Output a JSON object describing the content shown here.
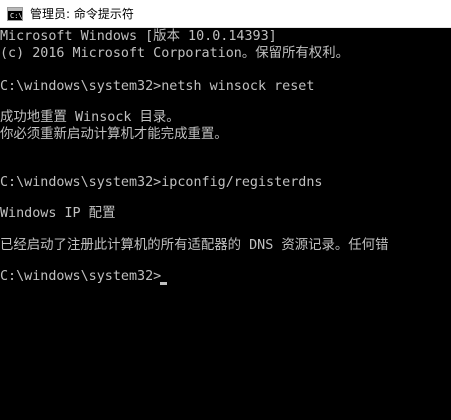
{
  "window": {
    "title": "管理员: 命令提示符",
    "icon": "cmd-icon",
    "icon_text": "C:\\",
    "background": "#000000",
    "text_color": "#c0c0c0"
  },
  "console": {
    "lines": [
      "Microsoft Windows [版本 10.0.14393]",
      "(c) 2016 Microsoft Corporation。保留所有权利。",
      "C:\\windows\\system32>netsh winsock reset",
      "成功地重置 Winsock 目录。",
      "你必须重新启动计算机才能完成重置。",
      "C:\\windows\\system32>ipconfig/registerdns",
      "Windows IP 配置",
      "已经启动了注册此计算机的所有适配器的 DNS 资源记录。任何错",
      "C:\\windows\\system32>"
    ]
  }
}
